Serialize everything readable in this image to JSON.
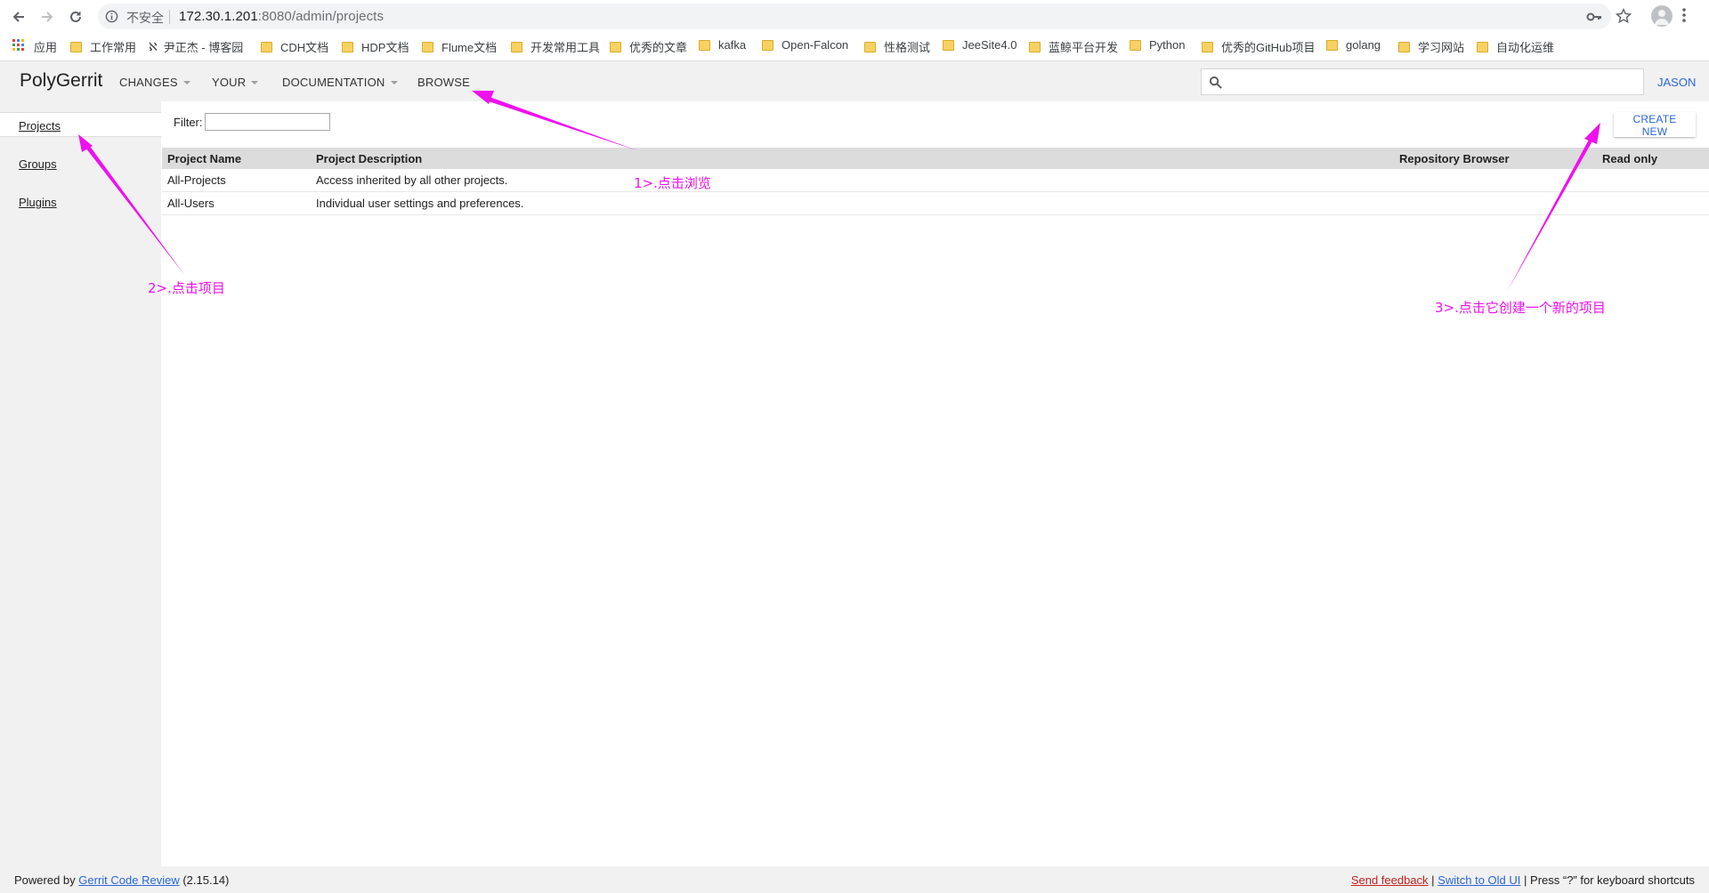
{
  "browser": {
    "security_label": "不安全",
    "url_host": "172.30.1.201",
    "url_rest": ":8080/admin/projects",
    "bookmarks": [
      "应用",
      "工作常用",
      "尹正杰 - 博客园",
      "CDH文档",
      "HDP文档",
      "Flume文档",
      "开发常用工具",
      "优秀的文章",
      "kafka",
      "Open-Falcon",
      "性格测试",
      "JeeSite4.0",
      "蓝鲸平台开发",
      "Python",
      "优秀的GitHub项目",
      "golang",
      "学习网站",
      "自动化运维"
    ]
  },
  "header": {
    "logo": "PolyGerrit",
    "menus": [
      "CHANGES",
      "YOUR",
      "DOCUMENTATION",
      "BROWSE"
    ],
    "user": "JASON",
    "search_value": ""
  },
  "sidebar": {
    "items": [
      {
        "label": "Projects",
        "active": true
      },
      {
        "label": "Groups",
        "active": false
      },
      {
        "label": "Plugins",
        "active": false
      }
    ]
  },
  "main": {
    "filter_label": "Filter:",
    "filter_value": "",
    "create_new_label": "CREATE NEW",
    "columns": [
      "Project Name",
      "Project Description",
      "Repository Browser",
      "Read only"
    ],
    "rows": [
      {
        "name": "All-Projects",
        "description": "Access inherited by all other projects.",
        "repo": "",
        "read_only": ""
      },
      {
        "name": "All-Users",
        "description": "Individual user settings and preferences.",
        "repo": "",
        "read_only": ""
      }
    ]
  },
  "footer": {
    "powered_by": "Powered by",
    "gerrit_link": "Gerrit Code Review",
    "version": "(2.15.14)",
    "send_feedback": "Send feedback",
    "separator": "|",
    "switch_old_ui": "Switch to Old UI",
    "shortcut_hint": "Press “?” for keyboard shortcuts"
  },
  "annotations": {
    "color": "#ee11ee",
    "step1": "1>.点击浏览",
    "step2": "2>.点击项目",
    "step3": "3>.点击它创建一个新的项目"
  }
}
